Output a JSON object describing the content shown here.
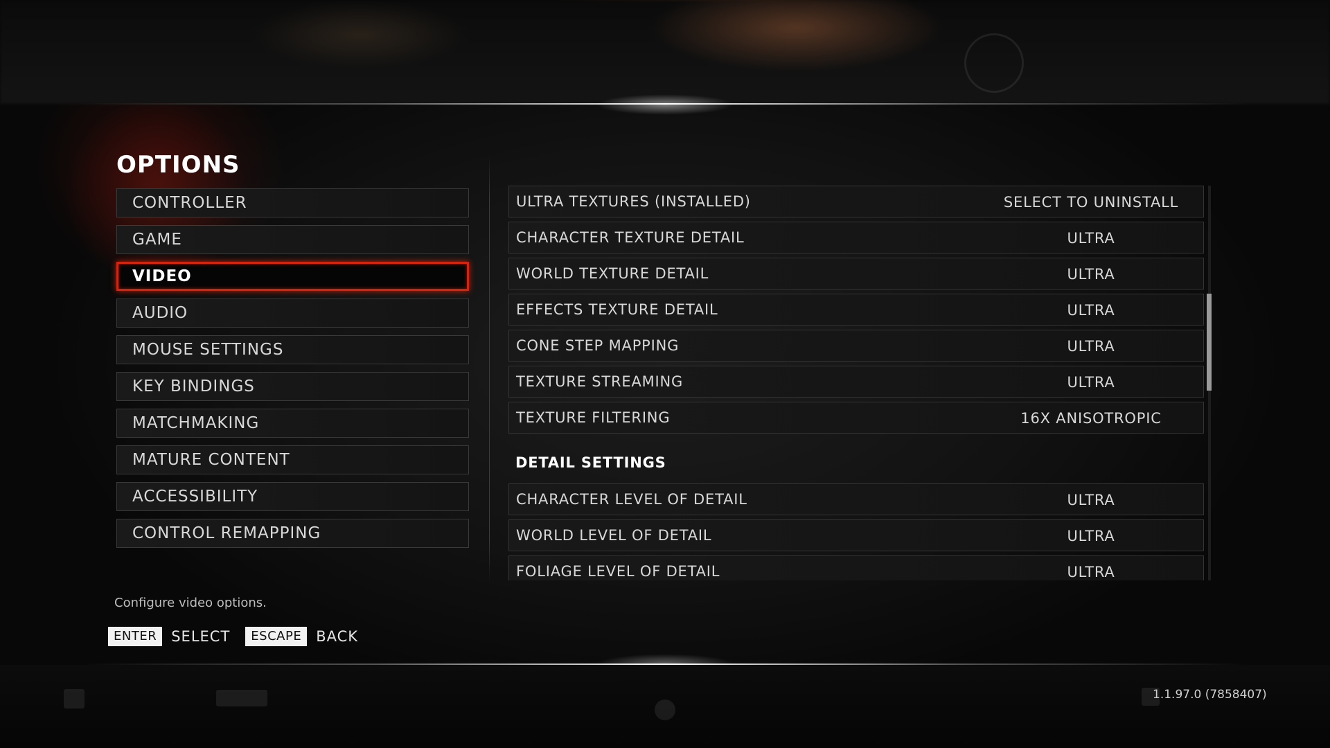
{
  "title": "OPTIONS",
  "menu": {
    "items": [
      {
        "label": "CONTROLLER"
      },
      {
        "label": "GAME"
      },
      {
        "label": "VIDEO"
      },
      {
        "label": "AUDIO"
      },
      {
        "label": "MOUSE SETTINGS"
      },
      {
        "label": "KEY BINDINGS"
      },
      {
        "label": "MATCHMAKING"
      },
      {
        "label": "MATURE CONTENT"
      },
      {
        "label": "ACCESSIBILITY"
      },
      {
        "label": "CONTROL REMAPPING"
      }
    ],
    "selected": "VIDEO"
  },
  "settings": {
    "rows": [
      {
        "label": "ULTRA TEXTURES (INSTALLED)",
        "value": "SELECT TO UNINSTALL"
      },
      {
        "label": "CHARACTER TEXTURE DETAIL",
        "value": "ULTRA"
      },
      {
        "label": "WORLD TEXTURE DETAIL",
        "value": "ULTRA"
      },
      {
        "label": "EFFECTS TEXTURE DETAIL",
        "value": "ULTRA"
      },
      {
        "label": "CONE STEP MAPPING",
        "value": "ULTRA"
      },
      {
        "label": "TEXTURE STREAMING",
        "value": "ULTRA"
      },
      {
        "label": "TEXTURE FILTERING",
        "value": "16X ANISOTROPIC"
      }
    ],
    "detail_section": {
      "header": "DETAIL SETTINGS",
      "rows": [
        {
          "label": "CHARACTER LEVEL OF DETAIL",
          "value": "ULTRA"
        },
        {
          "label": "WORLD LEVEL OF DETAIL",
          "value": "ULTRA"
        },
        {
          "label": "FOLIAGE LEVEL OF DETAIL",
          "value": "ULTRA"
        }
      ]
    }
  },
  "footer": {
    "description": "Configure video options.",
    "hints": [
      {
        "key": "ENTER",
        "action": "SELECT"
      },
      {
        "key": "ESCAPE",
        "action": "BACK"
      }
    ],
    "version": "1.1.97.0 (7858407)"
  },
  "colors": {
    "accent": "#d3240f",
    "background": "#121212",
    "text": "#d8d8d8"
  }
}
